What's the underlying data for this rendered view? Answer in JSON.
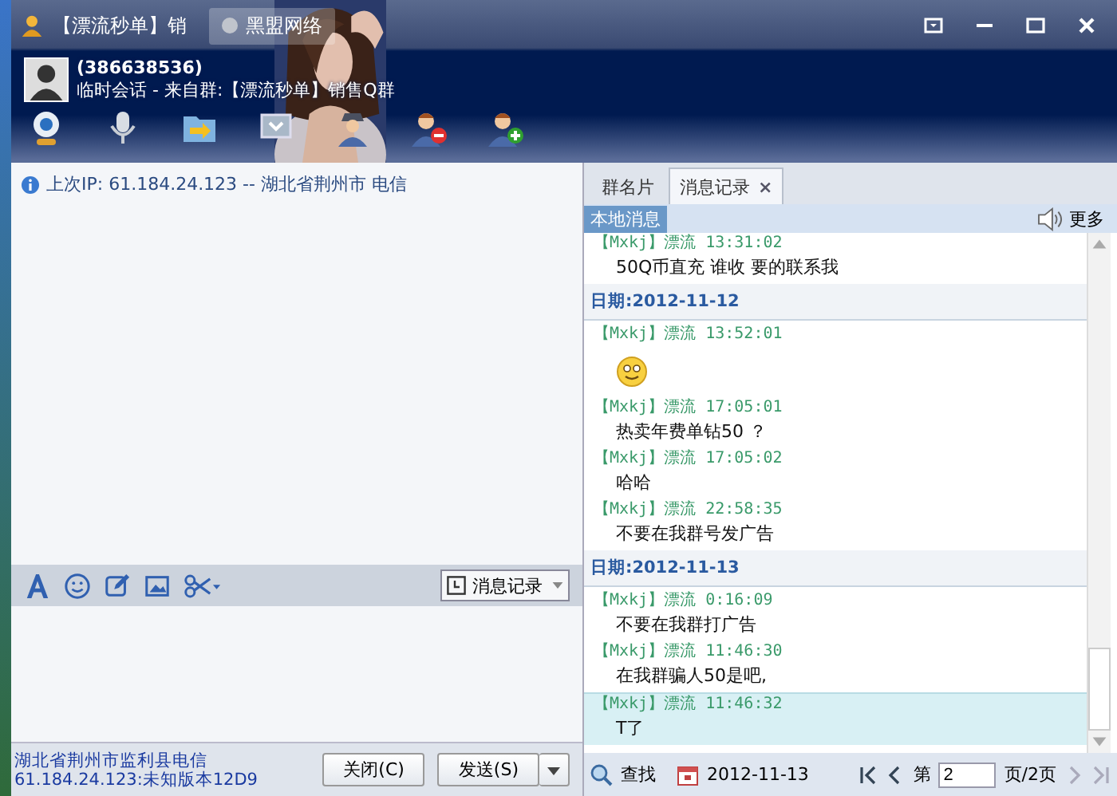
{
  "window": {
    "title": "【漂流秒单】销",
    "tab": "黑盟网络"
  },
  "contact": {
    "number": "(386638536)",
    "subtitle": "临时会话 - 来自群:【漂流秒单】销售Q群"
  },
  "info_bar": {
    "text": "上次IP: 61.184.24.123 -- 湖北省荆州市 电信"
  },
  "tabs": [
    {
      "label": "群名片",
      "selected": false
    },
    {
      "label": "消息记录",
      "selected": true,
      "close": "×"
    }
  ],
  "history": {
    "badge": "本地消息",
    "more": "更多",
    "items": [
      {
        "kind": "message",
        "header": "【Mxkj】漂流 13:31:02",
        "text": "50Q币直充 谁收 要的联系我",
        "selected": false
      },
      {
        "kind": "date",
        "label": "日期:2012-11-12"
      },
      {
        "kind": "emoji",
        "header": "【Mxkj】漂流 13:52:01",
        "selected": false
      },
      {
        "kind": "message",
        "header": "【Mxkj】漂流 17:05:01",
        "text": "热卖年费单钻50 ？",
        "selected": false
      },
      {
        "kind": "message",
        "header": "【Mxkj】漂流 17:05:02",
        "text": "哈哈",
        "selected": false
      },
      {
        "kind": "message",
        "header": "【Mxkj】漂流 22:58:35",
        "text": "不要在我群号发广告",
        "selected": false
      },
      {
        "kind": "date",
        "label": "日期:2012-11-13"
      },
      {
        "kind": "message",
        "header": "【Mxkj】漂流 0:16:09",
        "text": "不要在我群打广告",
        "selected": false
      },
      {
        "kind": "message",
        "header": "【Mxkj】漂流 11:46:30",
        "text": "在我群骗人50是吧,",
        "selected": false
      },
      {
        "kind": "message",
        "header": "【Mxkj】漂流 11:46:32",
        "text": "T了",
        "selected": true
      }
    ],
    "footer": {
      "search": "查找",
      "date": "2012-11-13",
      "page_prefix": "第",
      "page": "2",
      "page_suffix": "页/2页"
    }
  },
  "compose": {
    "history_button": "消息记录"
  },
  "status": {
    "location": "湖北省荆州市监利县电信",
    "version": "61.184.24.123:未知版本12D9"
  },
  "buttons": {
    "close": "关闭(C)",
    "send": "发送(S)"
  }
}
